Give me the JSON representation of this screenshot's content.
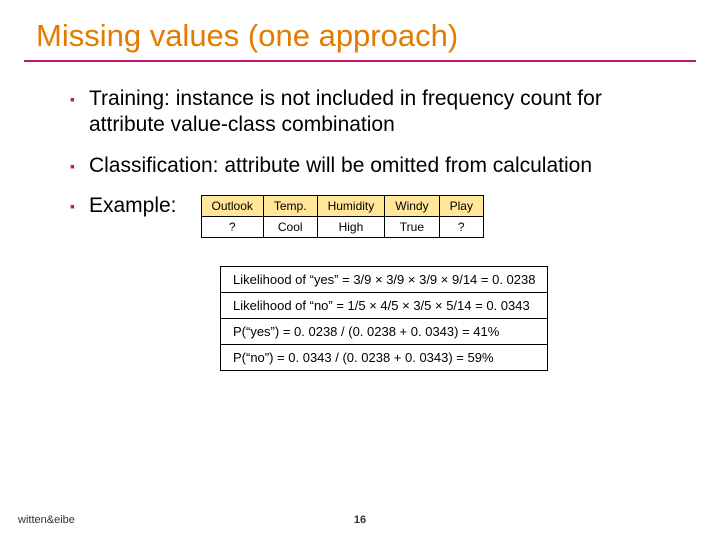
{
  "title": "Missing values (one approach)",
  "bullets": {
    "b1": "Training: instance is not included in frequency count for attribute value-class combination",
    "b2": "Classification: attribute will be omitted from calculation",
    "b3": "Example:"
  },
  "table": {
    "h0": "Outlook",
    "h1": "Temp.",
    "h2": "Humidity",
    "h3": "Windy",
    "h4": "Play",
    "r0": "?",
    "r1": "Cool",
    "r2": "High",
    "r3": "True",
    "r4": "?"
  },
  "calc": {
    "l1": "Likelihood of “yes” = 3/9 × 3/9 ×  3/9 × 9/14 = 0. 0238",
    "l2": "Likelihood of “no” = 1/5 × 4/5 × 3/5 × 5/14 = 0. 0343",
    "l3": "P(“yes”) = 0. 0238 / (0. 0238 + 0. 0343) = 41%",
    "l4": "P(“no”) = 0. 0343 / (0. 0238 + 0. 0343) = 59%"
  },
  "footer": "witten&eibe",
  "pagenum": "16",
  "chart_data": {
    "type": "table",
    "title": "Missing values (one approach)",
    "columns": [
      "Outlook",
      "Temp.",
      "Humidity",
      "Windy",
      "Play"
    ],
    "rows": [
      [
        "?",
        "Cool",
        "High",
        "True",
        "?"
      ]
    ],
    "calculations": [
      {
        "label": "Likelihood of “yes”",
        "expression": "3/9 × 3/9 × 3/9 × 9/14",
        "value": 0.0238
      },
      {
        "label": "Likelihood of “no”",
        "expression": "1/5 × 4/5 × 3/5 × 5/14",
        "value": 0.0343
      },
      {
        "label": "P(“yes”)",
        "expression": "0.0238 / (0.0238 + 0.0343)",
        "value": 0.41
      },
      {
        "label": "P(“no”)",
        "expression": "0.0343 / (0.0238 + 0.0343)",
        "value": 0.59
      }
    ]
  }
}
